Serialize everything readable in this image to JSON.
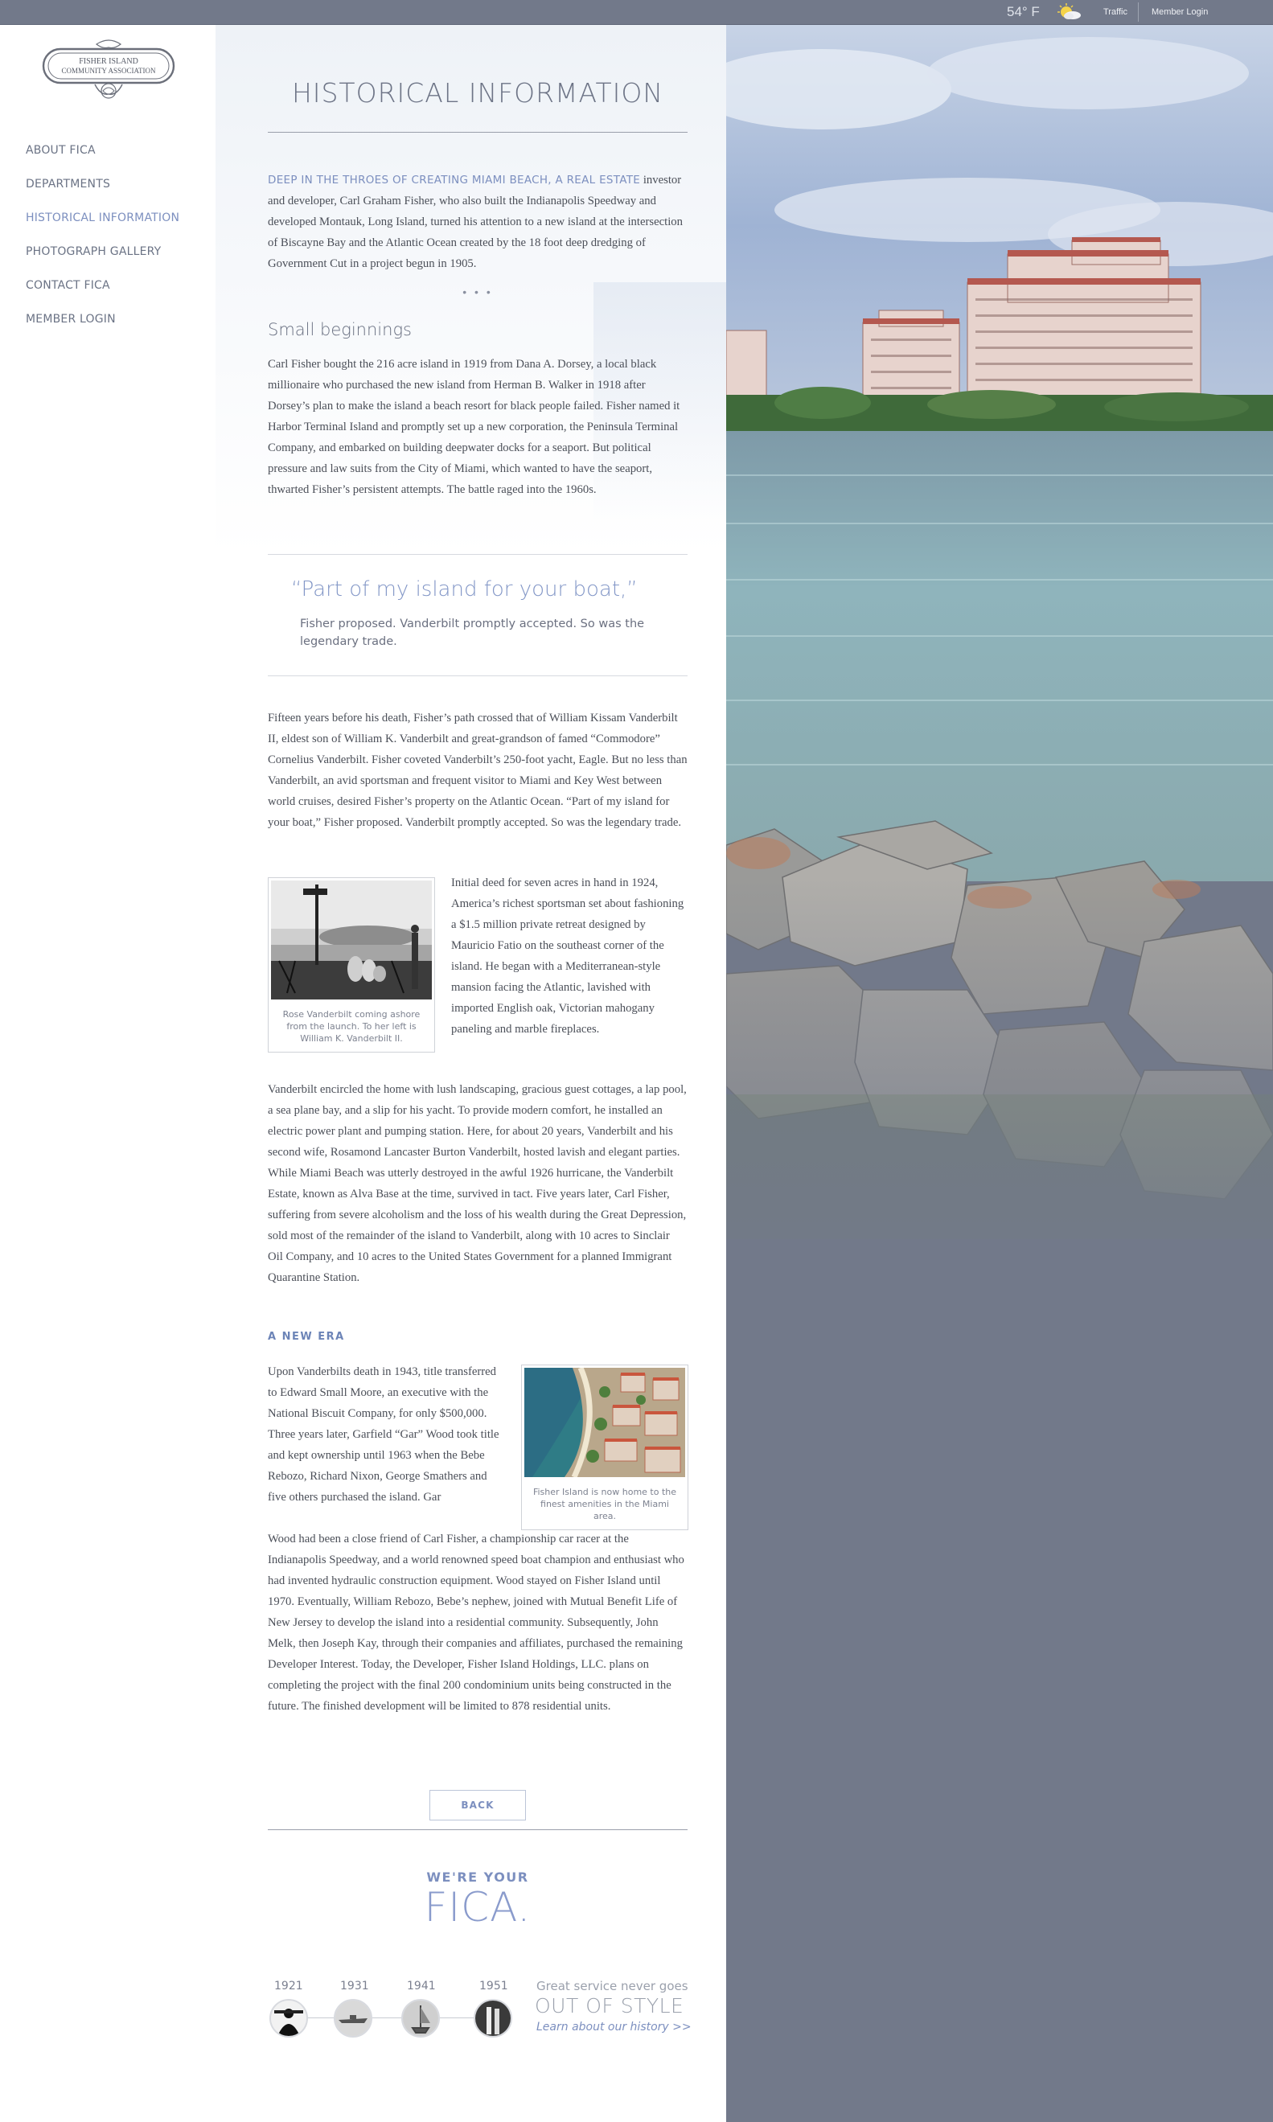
{
  "topbar": {
    "temperature": "54° F",
    "traffic_label": "Traffic",
    "login_label": "Member Login"
  },
  "logo": {
    "line1": "FISHER ISLAND",
    "line2": "COMMUNITY ASSOCIATION"
  },
  "nav": {
    "items": [
      {
        "label": "ABOUT FICA"
      },
      {
        "label": "DEPARTMENTS"
      },
      {
        "label": "HISTORICAL INFORMATION"
      },
      {
        "label": "PHOTOGRAPH GALLERY"
      },
      {
        "label": "CONTACT FICA"
      },
      {
        "label": "MEMBER LOGIN"
      }
    ]
  },
  "page": {
    "title": "HISTORICAL INFORMATION",
    "lead_caps": "DEEP IN THE THROES OF CREATING MIAMI BEACH, A REAL ESTATE",
    "lead_rest": "investor and developer, Carl Graham Fisher, who also built the Indianapolis Speedway and developed Montauk, Long Island, turned his attention to a new island at the intersection of Biscayne Bay and the Atlantic Ocean created by the 18 foot deep dredging of Government Cut in a project begun in 1905.",
    "dots": "• • •",
    "section1_title": "Small beginnings",
    "section1_body": "Carl Fisher bought the 216 acre island in 1919 from Dana A. Dorsey, a local black millionaire who purchased the new island from Herman B. Walker in 1918 after Dorsey’s plan to make the island a beach resort for black people failed. Fisher named it Harbor Terminal Island and promptly set up a new corporation, the Peninsula Terminal Company, and embarked on building deepwater docks for a seaport. But political pressure and law suits from the City of Miami, which wanted to have the seaport, thwarted Fisher’s persistent attempts. The battle raged into the 1960s.",
    "quote": "“Part of my island for your boat,”",
    "quote_sub": "Fisher proposed. Vanderbilt promptly accepted. So was the legendary trade.",
    "para_vanderbilt": "Fifteen years before his death, Fisher’s path crossed that of William Kissam Vanderbilt II, eldest son of William K. Vanderbilt and great-grandson of famed “Commodore” Cornelius Vanderbilt. Fisher coveted Vanderbilt’s 250-foot yacht, Eagle. But no less than Vanderbilt, an avid sportsman and frequent visitor to Miami and Key West between world cruises, desired Fisher’s property on the Atlantic Ocean. “Part of my island for your boat,” Fisher proposed. Vanderbilt promptly accepted. So was the legendary trade.",
    "figure1_caption": "Rose Vanderbilt coming ashore from the launch. To her left is William K. Vanderbilt II.",
    "para_deed": "Initial deed for seven acres in hand in 1924, America’s richest sportsman set about fashioning a $1.5 million private retreat designed by Mauricio Fatio on the southeast corner of the island. He began with a Mediterranean-style mansion facing the Atlantic, lavished with imported English oak, Victorian mahogany paneling and marble fireplaces.",
    "para_estate": "Vanderbilt encircled the home with lush landscaping, gracious guest cottages, a lap pool, a sea plane bay, and a slip for his yacht. To provide modern comfort, he installed an electric power plant and pumping station. Here, for about 20 years, Vanderbilt and his second wife, Rosamond Lancaster Burton Vanderbilt, hosted lavish and elegant parties. While Miami Beach was utterly destroyed in the awful 1926 hurricane, the Vanderbilt Estate, known as Alva Base at the time, survived in tact. Five years later, Carl Fisher, suffering from severe alcoholism and the loss of his wealth during the Great Depression, sold most of the remainder of the island to Vanderbilt, along with 10 acres to Sinclair Oil Company, and 10 acres to the United States Government for a planned Immigrant Quarantine Station.",
    "section2_title": "A NEW ERA",
    "para_newera_a": "Upon Vanderbilts death in 1943, title transferred to Edward Small Moore, an executive with the National Biscuit Company, for only $500,000. Three years later, Garfield “Gar” Wood took title and kept ownership until 1963 when the Bebe Rebozo, Richard Nixon, George Smathers and five others purchased the island. Gar",
    "para_newera_b": "Wood had been a close friend of Carl Fisher, a championship car racer at the Indianapolis Speedway, and a world renowned speed boat champion and enthusiast who had invented hydraulic construction equipment. Wood stayed on Fisher Island until 1970. Eventually, William Rebozo, Bebe’s nephew, joined with Mutual Benefit Life of New Jersey to develop the island into a residential community. Subsequently, John Melk, then Joseph Kay, through their companies and affiliates, purchased the remaining Developer Interest. Today, the Developer, Fisher Island Holdings, LLC. plans on completing the project with the final 200 condominium units being constructed in the future. The finished development will be limited to 878 residential units.",
    "figure2_caption": "Fisher Island is now home to the finest amenities in the Miami area.",
    "back_label": "BACK"
  },
  "footer": {
    "were_your": "WE'RE YOUR",
    "fica": "FICA.",
    "timeline_years": [
      "1921",
      "1931",
      "1941",
      "1951"
    ],
    "great_service": "Great service never goes",
    "out_of_style": "OUT OF STYLE",
    "history_link": "Learn about our history >>"
  },
  "colors": {
    "accent": "#7c8fbf",
    "topbar": "#72798a",
    "text": "#4b4f58"
  }
}
